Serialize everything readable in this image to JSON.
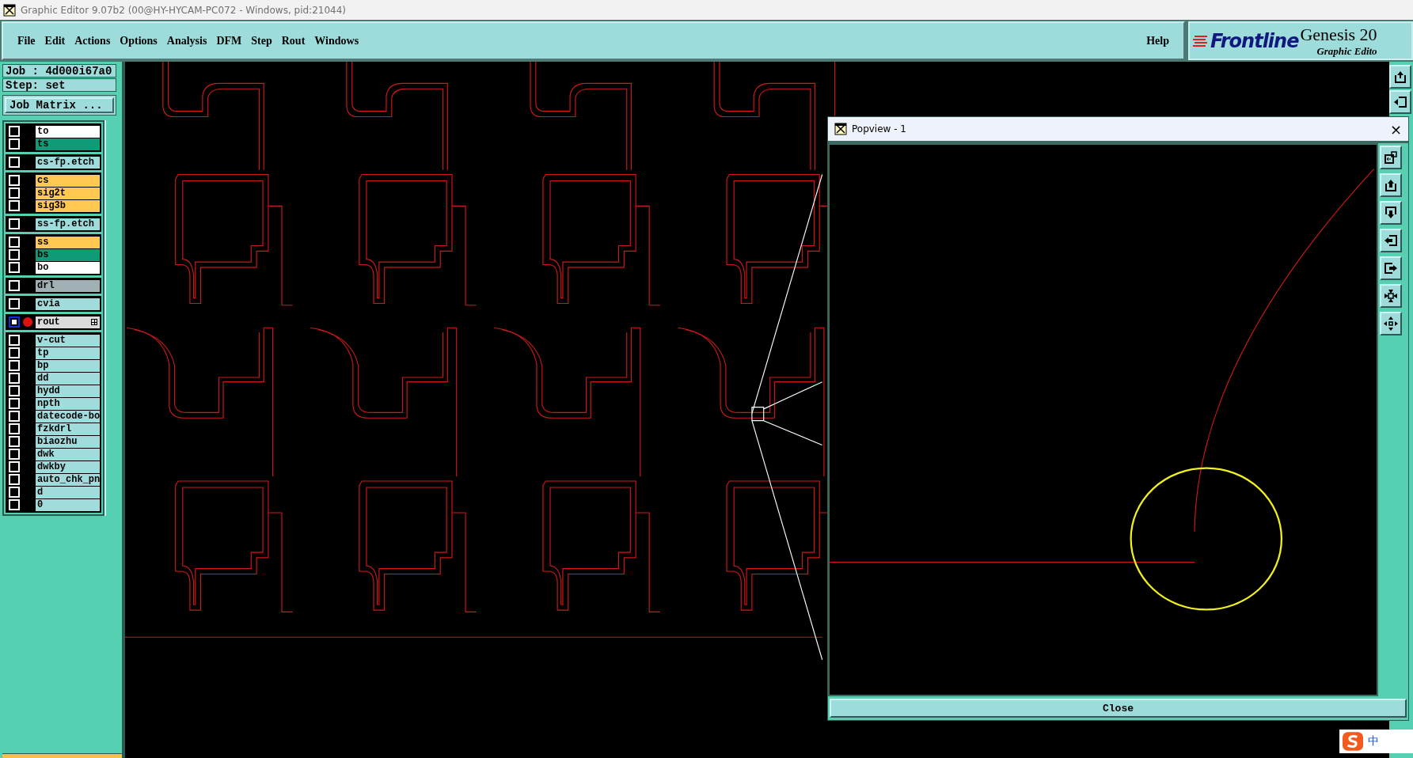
{
  "window": {
    "title": "Graphic Editor 9.07b2 (00@HY-HYCAM-PC072 - Windows, pid:21044)"
  },
  "menu": [
    "File",
    "Edit",
    "Actions",
    "Options",
    "Analysis",
    "DFM",
    "Step",
    "Rout",
    "Windows"
  ],
  "help": "Help",
  "logo": {
    "brand": "Frontline",
    "product": "Genesis 20",
    "subtitle": "Graphic Edito"
  },
  "job": {
    "job_label": "Job : 4d000i67a0",
    "step_label": "Step: set",
    "matrix_button": "Job Matrix ..."
  },
  "layer_groups": [
    {
      "layers": [
        {
          "name": "to",
          "color": "#ffffff",
          "work": false
        },
        {
          "name": "ts",
          "color": "#0f9a78",
          "work": false
        }
      ]
    },
    {
      "layers": [
        {
          "name": "cs-fp.etch",
          "color": "#a0dcdc",
          "work": false
        }
      ]
    },
    {
      "layers": [
        {
          "name": "cs",
          "color": "#ffc850",
          "work": false
        },
        {
          "name": "sig2t",
          "color": "#ffc850",
          "work": false
        },
        {
          "name": "sig3b",
          "color": "#ffc850",
          "work": false
        }
      ]
    },
    {
      "layers": [
        {
          "name": "ss-fp.etch",
          "color": "#a0dcdc",
          "work": false
        }
      ]
    },
    {
      "layers": [
        {
          "name": "ss",
          "color": "#ffc850",
          "work": false
        },
        {
          "name": "bs",
          "color": "#0f9a78",
          "work": false
        },
        {
          "name": "bo",
          "color": "#ffffff",
          "work": false
        }
      ]
    },
    {
      "layers": [
        {
          "name": "drl",
          "color": "#a0b0b4",
          "work": false
        }
      ]
    },
    {
      "layers": [
        {
          "name": "cvia",
          "color": "#a0dcdc",
          "work": false
        }
      ]
    },
    {
      "layers": [
        {
          "name": "rout",
          "color": "#dcdcdc",
          "work": true
        }
      ]
    },
    {
      "layers": [
        {
          "name": "v-cut",
          "color": "#a0dcdc",
          "work": false
        },
        {
          "name": "tp",
          "color": "#a0dcdc",
          "work": false
        },
        {
          "name": "bp",
          "color": "#a0dcdc",
          "work": false
        },
        {
          "name": "dd",
          "color": "#a0dcdc",
          "work": false
        },
        {
          "name": "hydd",
          "color": "#a0dcdc",
          "work": false
        },
        {
          "name": "npth",
          "color": "#a0dcdc",
          "work": false
        },
        {
          "name": "datecode-bo",
          "color": "#a0dcdc",
          "work": false
        },
        {
          "name": "fzkdrl",
          "color": "#a0dcdc",
          "work": false
        },
        {
          "name": "biaozhu",
          "color": "#a0dcdc",
          "work": false
        },
        {
          "name": "dwk",
          "color": "#a0dcdc",
          "work": false
        },
        {
          "name": "dwkby",
          "color": "#a0dcdc",
          "work": false
        },
        {
          "name": "auto_chk_pn",
          "color": "#a0dcdc",
          "work": false
        },
        {
          "name": "d",
          "color": "#a0dcdc",
          "work": false
        },
        {
          "name": "0",
          "color": "#a0dcdc",
          "work": false
        }
      ]
    }
  ],
  "popview": {
    "title": "Popview - 1",
    "close_icon": "×",
    "close_button": "Close"
  },
  "ime": {
    "mode": "中"
  }
}
